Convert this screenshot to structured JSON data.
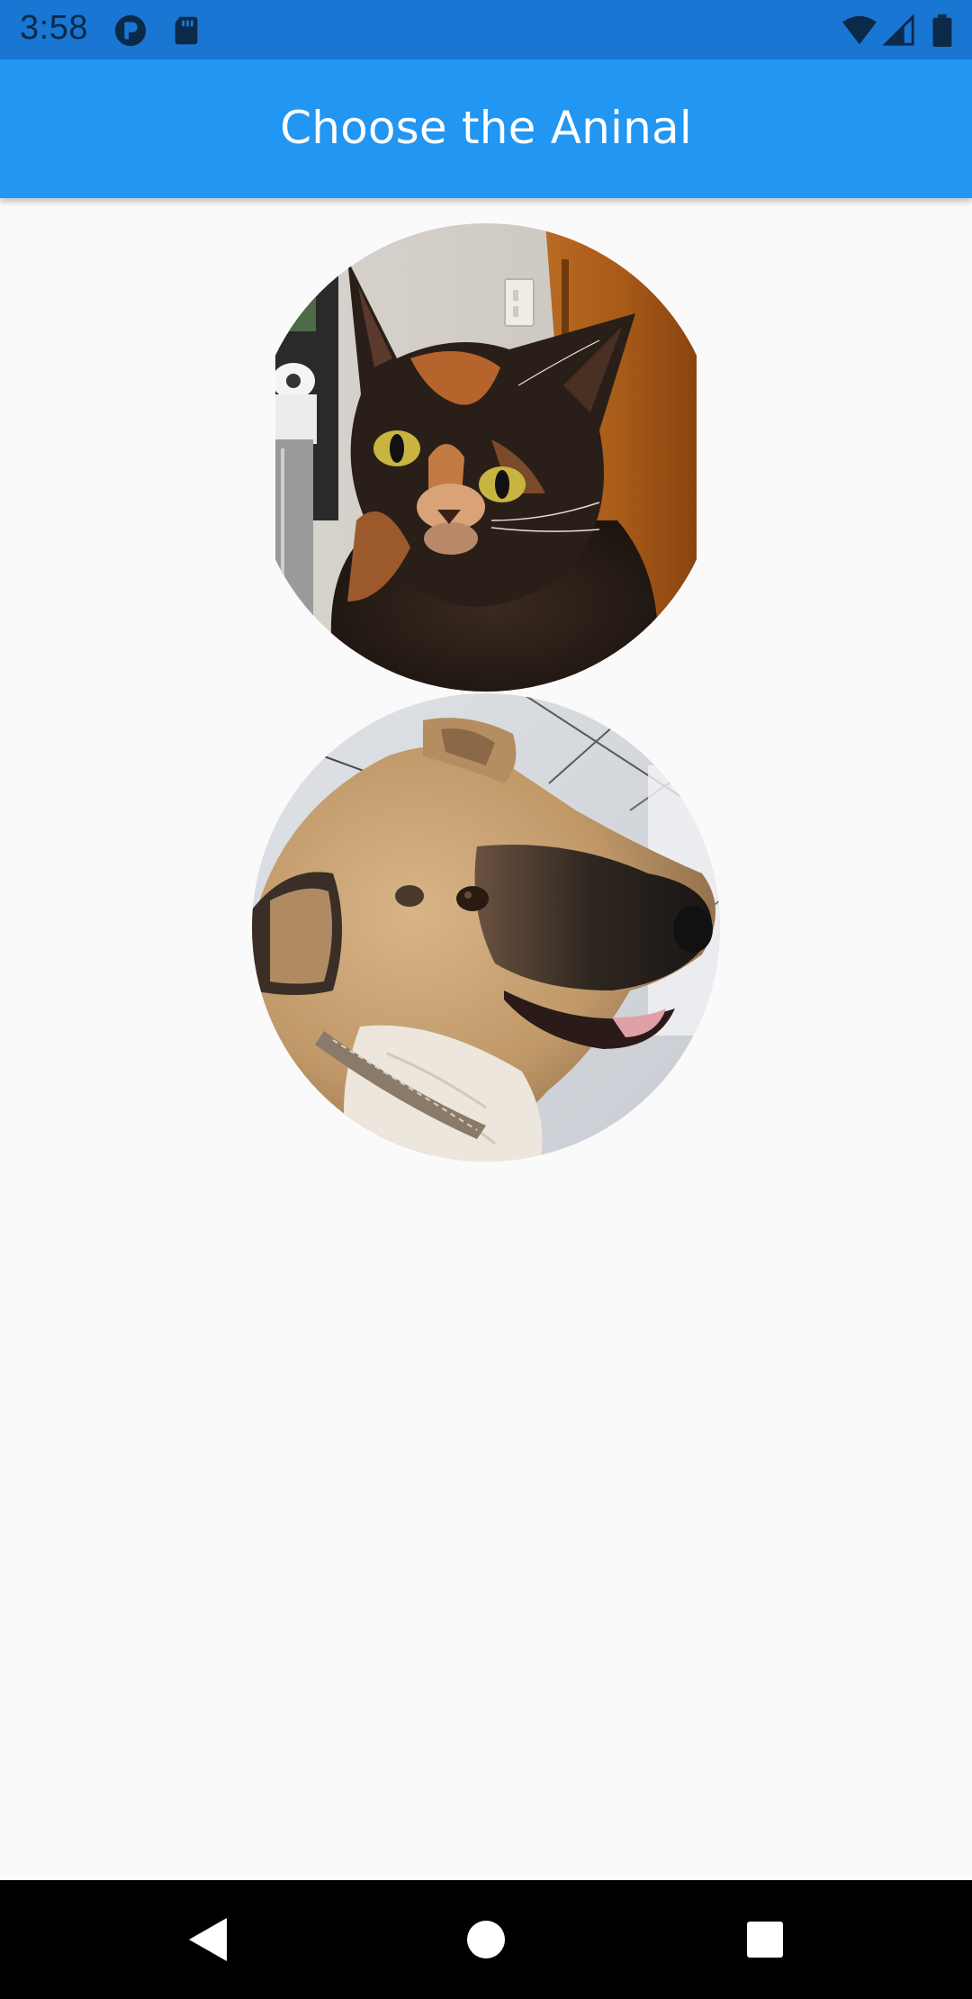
{
  "status_bar": {
    "time": "3:58",
    "icons": [
      "app-notification-icon",
      "sd-card-icon",
      "wifi-icon",
      "cell-signal-icon",
      "battery-icon"
    ],
    "background": "#1976d2"
  },
  "app_bar": {
    "title": "Choose the Aninal",
    "background": "#2196f3",
    "title_color": "#ffffff"
  },
  "animals": [
    {
      "id": "cat",
      "image": "cat-photo"
    },
    {
      "id": "dog",
      "image": "dog-photo"
    }
  ],
  "nav_bar": {
    "buttons": [
      "back-icon",
      "home-icon",
      "recents-icon"
    ],
    "background": "#000000"
  },
  "page_background": "#fafafa"
}
